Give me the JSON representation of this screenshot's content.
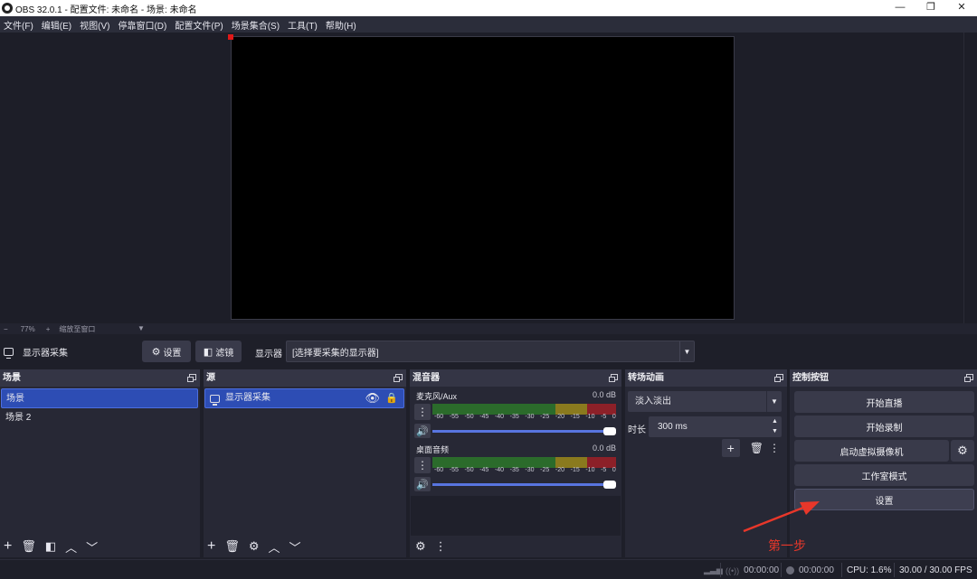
{
  "window": {
    "title": "OBS 32.0.1 - 配置文件: 未命名 - 场景: 未命名",
    "minimize": "—",
    "restore": "❐",
    "close": "✕"
  },
  "menu": [
    "文件(F)",
    "编辑(E)",
    "视图(V)",
    "停靠窗口(D)",
    "配置文件(P)",
    "场景集合(S)",
    "工具(T)",
    "帮助(H)"
  ],
  "zoom": {
    "minus": "−",
    "value": "77%",
    "plus": "+",
    "mode": "缩放至窗口"
  },
  "source_toolbar": {
    "source_name": "显示器采集",
    "settings_label": "设置",
    "filters_label": "滤镜",
    "display_label": "显示器",
    "display_value": "[选择要采集的显示器]"
  },
  "scenes": {
    "title": "场景",
    "items": [
      "场景",
      "场景 2"
    ]
  },
  "sources": {
    "title": "源",
    "items": [
      "显示器采集"
    ]
  },
  "mixer": {
    "title": "混音器",
    "channels": [
      {
        "name": "麦克风/Aux",
        "db": "0.0 dB"
      },
      {
        "name": "桌面音频",
        "db": "0.0 dB"
      }
    ],
    "scale": [
      "-60",
      "-55",
      "-50",
      "-45",
      "-40",
      "-35",
      "-30",
      "-25",
      "-20",
      "-15",
      "-10",
      "-5",
      "0"
    ]
  },
  "transitions": {
    "title": "转场动画",
    "selected": "淡入淡出",
    "duration_label": "时长",
    "duration_value": "300 ms"
  },
  "controls": {
    "title": "控制按钮",
    "start_stream": "开始直播",
    "start_record": "开始录制",
    "virtual_cam": "启动虚拟摄像机",
    "studio_mode": "工作室模式",
    "settings": "设置"
  },
  "annotation": {
    "text": "第一步",
    "color": "#e8372a"
  },
  "status": {
    "stream_time": "00:00:00",
    "record_time": "00:00:00",
    "cpu": "CPU: 1.6%",
    "fps": "30.00 / 30.00 FPS"
  },
  "colors": {
    "accent": "#2d4db4",
    "background": "#1e1f29",
    "panel": "#272835"
  }
}
